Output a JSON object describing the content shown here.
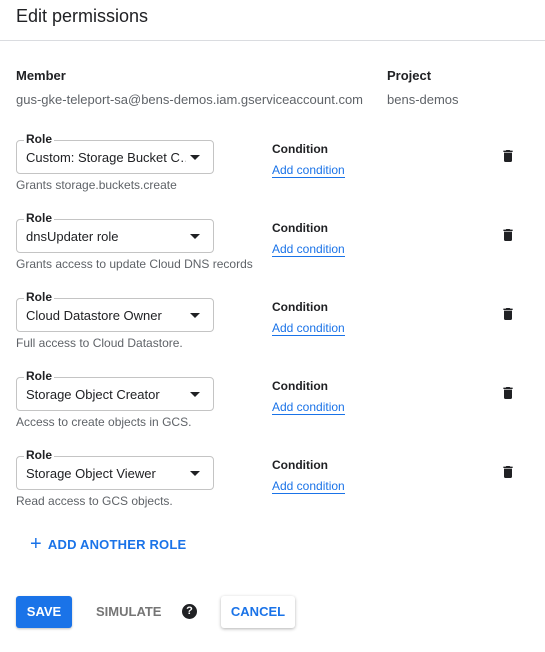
{
  "dialog": {
    "title": "Edit permissions"
  },
  "member": {
    "label": "Member",
    "value": "gus-gke-teleport-sa@bens-demos.iam.gserviceaccount.com"
  },
  "project": {
    "label": "Project",
    "value": "bens-demos"
  },
  "roles": [
    {
      "legend": "Role",
      "value": "Custom: Storage Bucket C…",
      "description": "Grants storage.buckets.create",
      "condition_label": "Condition",
      "condition_link": "Add condition"
    },
    {
      "legend": "Role",
      "value": "dnsUpdater role",
      "description": "Grants access to update Cloud DNS records",
      "condition_label": "Condition",
      "condition_link": "Add condition"
    },
    {
      "legend": "Role",
      "value": "Cloud Datastore Owner",
      "description": "Full access to Cloud Datastore.",
      "condition_label": "Condition",
      "condition_link": "Add condition"
    },
    {
      "legend": "Role",
      "value": "Storage Object Creator",
      "description": "Access to create objects in GCS.",
      "condition_label": "Condition",
      "condition_link": "Add condition"
    },
    {
      "legend": "Role",
      "value": "Storage Object Viewer",
      "description": "Read access to GCS objects.",
      "condition_label": "Condition",
      "condition_link": "Add condition"
    }
  ],
  "add_role": {
    "icon": "plus-icon",
    "label": "ADD ANOTHER ROLE"
  },
  "footer": {
    "save_label": "SAVE",
    "simulate_label": "SIMULATE",
    "help_icon": "help-icon",
    "help_glyph": "?",
    "cancel_label": "CANCEL"
  },
  "colors": {
    "primary": "#1a73e8",
    "text": "#202124",
    "secondary_text": "#5f6368",
    "border": "#c4c4c4",
    "divider": "#dadce0"
  }
}
